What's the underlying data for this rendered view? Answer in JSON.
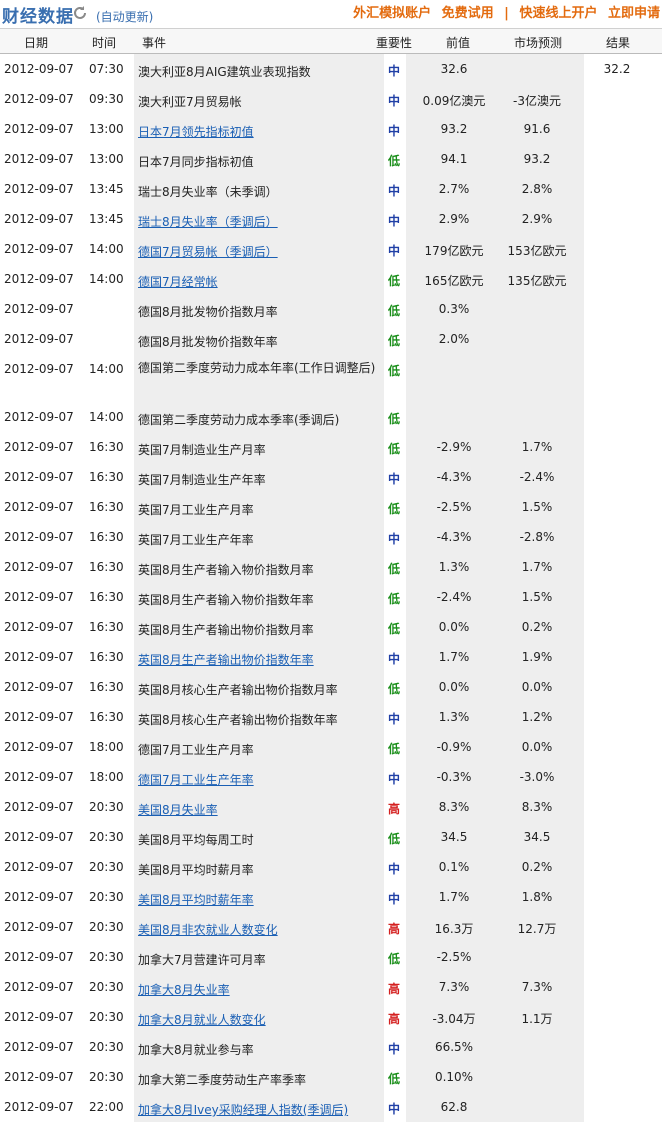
{
  "header": {
    "title": "财经数据",
    "auto_update": "(自动更新)",
    "promo": [
      "外汇模拟账户",
      "免费试用",
      "快速线上开户",
      "立即申请"
    ],
    "separator": "|"
  },
  "columns": {
    "date": "日期",
    "time": "时间",
    "event": "事件",
    "importance": "重要性",
    "previous": "前值",
    "forecast": "市场预测",
    "result": "结果"
  },
  "colors": {
    "title": "#3a6fb0",
    "promo": "#e36b0f",
    "link": "#1a5fb4",
    "mid": "#1f3fa6",
    "low": "#1b8f1b",
    "high": "#d42020"
  },
  "rows": [
    {
      "date": "2012-09-07",
      "time": "07:30",
      "event": "澳大利亚8月AIG建筑业表现指数",
      "link": false,
      "importance": "中",
      "previous": "32.6",
      "forecast": "",
      "result": "32.2"
    },
    {
      "date": "2012-09-07",
      "time": "09:30",
      "event": "澳大利亚7月贸易帐",
      "link": false,
      "importance": "中",
      "previous": "0.09亿澳元",
      "forecast": "-3亿澳元",
      "result": ""
    },
    {
      "date": "2012-09-07",
      "time": "13:00",
      "event": "日本7月领先指标初值",
      "link": true,
      "importance": "中",
      "previous": "93.2",
      "forecast": "91.6",
      "result": ""
    },
    {
      "date": "2012-09-07",
      "time": "13:00",
      "event": "日本7月同步指标初值",
      "link": false,
      "importance": "低",
      "previous": "94.1",
      "forecast": "93.2",
      "result": ""
    },
    {
      "date": "2012-09-07",
      "time": "13:45",
      "event": "瑞士8月失业率（未季调）",
      "link": false,
      "importance": "中",
      "previous": "2.7%",
      "forecast": "2.8%",
      "result": ""
    },
    {
      "date": "2012-09-07",
      "time": "13:45",
      "event": "瑞士8月失业率（季调后）",
      "link": true,
      "importance": "中",
      "previous": "2.9%",
      "forecast": "2.9%",
      "result": ""
    },
    {
      "date": "2012-09-07",
      "time": "14:00",
      "event": "德国7月贸易帐（季调后）",
      "link": true,
      "importance": "中",
      "previous": "179亿欧元",
      "forecast": "153亿欧元",
      "result": ""
    },
    {
      "date": "2012-09-07",
      "time": "14:00",
      "event": "德国7月经常帐",
      "link": true,
      "importance": "低",
      "previous": "165亿欧元",
      "forecast": "135亿欧元",
      "result": ""
    },
    {
      "date": "2012-09-07",
      "time": "",
      "event": "德国8月批发物价指数月率",
      "link": false,
      "importance": "低",
      "previous": "0.3%",
      "forecast": "",
      "result": ""
    },
    {
      "date": "2012-09-07",
      "time": "",
      "event": "德国8月批发物价指数年率",
      "link": false,
      "importance": "低",
      "previous": "2.0%",
      "forecast": "",
      "result": ""
    },
    {
      "date": "2012-09-07",
      "time": "14:00",
      "event": "德国第二季度劳动力成本年率(工作日调整后)",
      "link": false,
      "importance": "低",
      "previous": "",
      "forecast": "",
      "result": "",
      "tall": true
    },
    {
      "date": "2012-09-07",
      "time": "14:00",
      "event": "德国第二季度劳动力成本季率(季调后)",
      "link": false,
      "importance": "低",
      "previous": "",
      "forecast": "",
      "result": ""
    },
    {
      "date": "2012-09-07",
      "time": "16:30",
      "event": "英国7月制造业生产月率",
      "link": false,
      "importance": "低",
      "previous": "-2.9%",
      "forecast": "1.7%",
      "result": ""
    },
    {
      "date": "2012-09-07",
      "time": "16:30",
      "event": "英国7月制造业生产年率",
      "link": false,
      "importance": "中",
      "previous": "-4.3%",
      "forecast": "-2.4%",
      "result": ""
    },
    {
      "date": "2012-09-07",
      "time": "16:30",
      "event": "英国7月工业生产月率",
      "link": false,
      "importance": "低",
      "previous": "-2.5%",
      "forecast": "1.5%",
      "result": ""
    },
    {
      "date": "2012-09-07",
      "time": "16:30",
      "event": "英国7月工业生产年率",
      "link": false,
      "importance": "中",
      "previous": "-4.3%",
      "forecast": "-2.8%",
      "result": ""
    },
    {
      "date": "2012-09-07",
      "time": "16:30",
      "event": "英国8月生产者输入物价指数月率",
      "link": false,
      "importance": "低",
      "previous": "1.3%",
      "forecast": "1.7%",
      "result": ""
    },
    {
      "date": "2012-09-07",
      "time": "16:30",
      "event": "英国8月生产者输入物价指数年率",
      "link": false,
      "importance": "低",
      "previous": "-2.4%",
      "forecast": "1.5%",
      "result": ""
    },
    {
      "date": "2012-09-07",
      "time": "16:30",
      "event": "英国8月生产者输出物价指数月率",
      "link": false,
      "importance": "低",
      "previous": "0.0%",
      "forecast": "0.2%",
      "result": ""
    },
    {
      "date": "2012-09-07",
      "time": "16:30",
      "event": "英国8月生产者输出物价指数年率",
      "link": true,
      "importance": "中",
      "previous": "1.7%",
      "forecast": "1.9%",
      "result": ""
    },
    {
      "date": "2012-09-07",
      "time": "16:30",
      "event": "英国8月核心生产者输出物价指数月率",
      "link": false,
      "importance": "低",
      "previous": "0.0%",
      "forecast": "0.0%",
      "result": ""
    },
    {
      "date": "2012-09-07",
      "time": "16:30",
      "event": "英国8月核心生产者输出物价指数年率",
      "link": false,
      "importance": "中",
      "previous": "1.3%",
      "forecast": "1.2%",
      "result": ""
    },
    {
      "date": "2012-09-07",
      "time": "18:00",
      "event": "德国7月工业生产月率",
      "link": false,
      "importance": "低",
      "previous": "-0.9%",
      "forecast": "0.0%",
      "result": ""
    },
    {
      "date": "2012-09-07",
      "time": "18:00",
      "event": "德国7月工业生产年率",
      "link": true,
      "importance": "中",
      "previous": "-0.3%",
      "forecast": "-3.0%",
      "result": ""
    },
    {
      "date": "2012-09-07",
      "time": "20:30",
      "event": "美国8月失业率",
      "link": true,
      "importance": "高",
      "previous": "8.3%",
      "forecast": "8.3%",
      "result": ""
    },
    {
      "date": "2012-09-07",
      "time": "20:30",
      "event": "美国8月平均每周工时",
      "link": false,
      "importance": "低",
      "previous": "34.5",
      "forecast": "34.5",
      "result": ""
    },
    {
      "date": "2012-09-07",
      "time": "20:30",
      "event": "美国8月平均时薪月率",
      "link": false,
      "importance": "中",
      "previous": "0.1%",
      "forecast": "0.2%",
      "result": ""
    },
    {
      "date": "2012-09-07",
      "time": "20:30",
      "event": "美国8月平均时薪年率",
      "link": true,
      "importance": "中",
      "previous": "1.7%",
      "forecast": "1.8%",
      "result": ""
    },
    {
      "date": "2012-09-07",
      "time": "20:30",
      "event": "美国8月非农就业人数变化",
      "link": true,
      "importance": "高",
      "previous": "16.3万",
      "forecast": "12.7万",
      "result": ""
    },
    {
      "date": "2012-09-07",
      "time": "20:30",
      "event": "加拿大7月营建许可月率",
      "link": false,
      "importance": "低",
      "previous": "-2.5%",
      "forecast": "",
      "result": ""
    },
    {
      "date": "2012-09-07",
      "time": "20:30",
      "event": "加拿大8月失业率",
      "link": true,
      "importance": "高",
      "previous": "7.3%",
      "forecast": "7.3%",
      "result": ""
    },
    {
      "date": "2012-09-07",
      "time": "20:30",
      "event": "加拿大8月就业人数变化",
      "link": true,
      "importance": "高",
      "previous": "-3.04万",
      "forecast": "1.1万",
      "result": ""
    },
    {
      "date": "2012-09-07",
      "time": "20:30",
      "event": "加拿大8月就业参与率",
      "link": false,
      "importance": "中",
      "previous": "66.5%",
      "forecast": "",
      "result": ""
    },
    {
      "date": "2012-09-07",
      "time": "20:30",
      "event": "加拿大第二季度劳动生产率季率",
      "link": false,
      "importance": "低",
      "previous": "0.10%",
      "forecast": "",
      "result": ""
    },
    {
      "date": "2012-09-07",
      "time": "22:00",
      "event": "加拿大8月Ivey采购经理人指数(季调后)",
      "link": true,
      "importance": "中",
      "previous": "62.8",
      "forecast": "",
      "result": ""
    }
  ]
}
